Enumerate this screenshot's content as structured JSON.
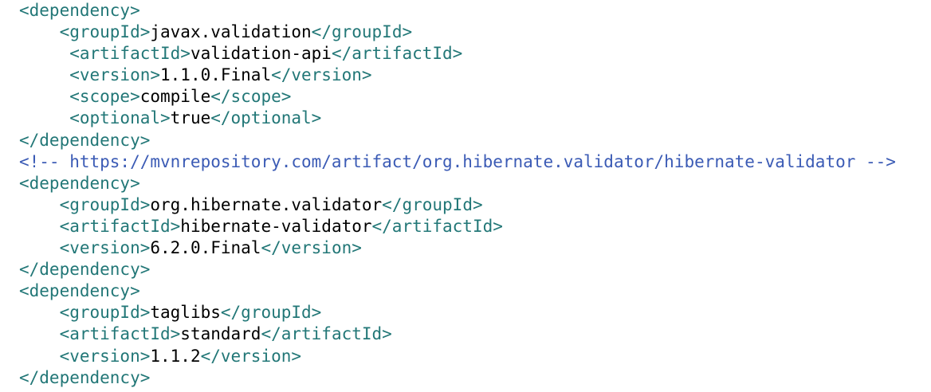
{
  "editor": {
    "tag_color": "#227777",
    "comment_color": "#3b5bb5",
    "text_color": "#000000",
    "lines": [
      {
        "indent": "",
        "open": "<dependency>"
      },
      {
        "indent": "    ",
        "open": "<groupId>",
        "value": "javax.validation",
        "close": "</groupId>"
      },
      {
        "indent": "     ",
        "open": "<artifactId>",
        "value": "validation-api",
        "close": "</artifactId>"
      },
      {
        "indent": "     ",
        "open": "<version>",
        "value": "1.1.0.Final",
        "close": "</version>"
      },
      {
        "indent": "     ",
        "open": "<scope>",
        "value": "compile",
        "close": "</scope>"
      },
      {
        "indent": "     ",
        "open": "<optional>",
        "value": "true",
        "close": "</optional>"
      },
      {
        "indent": "",
        "open": "</dependency>"
      },
      {
        "indent": "",
        "comment": "<!-- https://mvnrepository.com/artifact/org.hibernate.validator/hibernate-validator -->"
      },
      {
        "indent": "",
        "open": "<dependency>"
      },
      {
        "indent": "    ",
        "open": "<groupId>",
        "value": "org.hibernate.validator",
        "close": "</groupId>"
      },
      {
        "indent": "    ",
        "open": "<artifactId>",
        "value": "hibernate-validator",
        "close": "</artifactId>"
      },
      {
        "indent": "    ",
        "open": "<version>",
        "value": "6.2.0.Final",
        "close": "</version>"
      },
      {
        "indent": "",
        "open": "</dependency>"
      },
      {
        "indent": "",
        "open": "<dependency>"
      },
      {
        "indent": "    ",
        "open": "<groupId>",
        "value": "taglibs",
        "close": "</groupId>"
      },
      {
        "indent": "    ",
        "open": "<artifactId>",
        "value": "standard",
        "close": "</artifactId>"
      },
      {
        "indent": "    ",
        "open": "<version>",
        "value": "1.1.2",
        "close": "</version>"
      },
      {
        "indent": "",
        "open": "</dependency>"
      }
    ]
  }
}
